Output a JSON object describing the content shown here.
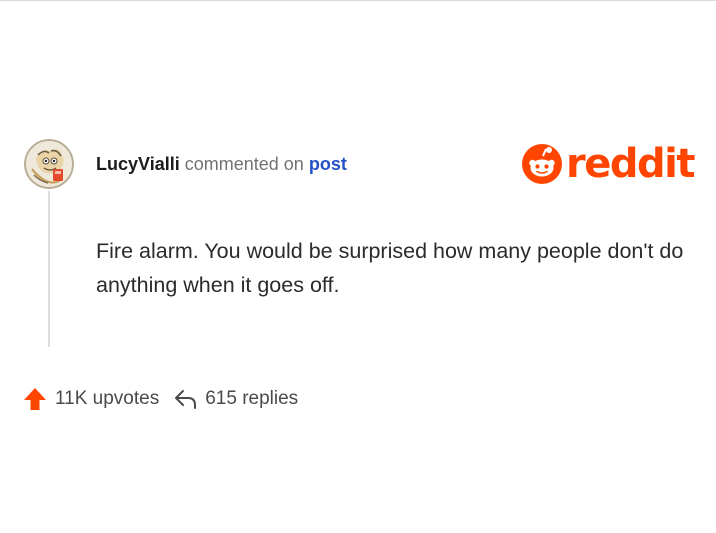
{
  "colors": {
    "brand": "#ff4500",
    "link": "#2552c9",
    "text": "#2b2b2b",
    "muted": "#737373"
  },
  "comment": {
    "username": "LucyVialli",
    "action_text": "commented on",
    "target_link": "post",
    "body": "Fire alarm. You would be surprised how many people don't do anything when it goes off."
  },
  "logo": {
    "icon": "reddit-snoo-icon",
    "wordmark": "reddit"
  },
  "stats": {
    "upvote_icon": "upvote-arrow-icon",
    "upvotes_label": "11K upvotes",
    "reply_icon": "reply-arrow-icon",
    "replies_label": "615 replies"
  }
}
